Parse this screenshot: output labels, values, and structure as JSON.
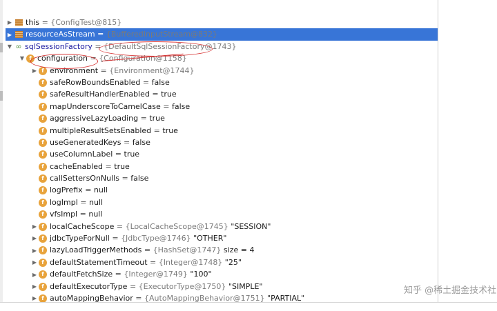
{
  "rows": [
    {
      "indent": 0,
      "arrow": "collapsed",
      "icon": "list",
      "name": "this",
      "eq": " = ",
      "ref": "{ConfigTest@815}",
      "value": ""
    },
    {
      "indent": 0,
      "arrow": "collapsed",
      "icon": "list",
      "name": "resourceAsStream",
      "eq": " = ",
      "ref": "{BufferedInputStream@832}",
      "value": "",
      "selected": true
    },
    {
      "indent": 0,
      "arrow": "expanded",
      "icon": "link",
      "name": "sqlSessionFactory",
      "eq": " = ",
      "ref": "{DefaultSqlSessionFactory@1743}",
      "value": "",
      "highlight": true
    },
    {
      "indent": 1,
      "arrow": "expanded",
      "icon": "field",
      "name": "configuration",
      "eq": " = ",
      "ref": "{Configuration@1158}",
      "value": ""
    },
    {
      "indent": 2,
      "arrow": "collapsed",
      "icon": "field",
      "name": "environment",
      "eq": " = ",
      "ref": "{Environment@1744}",
      "value": ""
    },
    {
      "indent": 2,
      "arrow": "none",
      "icon": "field",
      "name": "safeRowBoundsEnabled",
      "eq": " = ",
      "ref": "",
      "value": "false"
    },
    {
      "indent": 2,
      "arrow": "none",
      "icon": "field",
      "name": "safeResultHandlerEnabled",
      "eq": " = ",
      "ref": "",
      "value": "true"
    },
    {
      "indent": 2,
      "arrow": "none",
      "icon": "field",
      "name": "mapUnderscoreToCamelCase",
      "eq": " = ",
      "ref": "",
      "value": "false"
    },
    {
      "indent": 2,
      "arrow": "none",
      "icon": "field",
      "name": "aggressiveLazyLoading",
      "eq": " = ",
      "ref": "",
      "value": "true"
    },
    {
      "indent": 2,
      "arrow": "none",
      "icon": "field",
      "name": "multipleResultSetsEnabled",
      "eq": " = ",
      "ref": "",
      "value": "true"
    },
    {
      "indent": 2,
      "arrow": "none",
      "icon": "field",
      "name": "useGeneratedKeys",
      "eq": " = ",
      "ref": "",
      "value": "false"
    },
    {
      "indent": 2,
      "arrow": "none",
      "icon": "field",
      "name": "useColumnLabel",
      "eq": " = ",
      "ref": "",
      "value": "true"
    },
    {
      "indent": 2,
      "arrow": "none",
      "icon": "field",
      "name": "cacheEnabled",
      "eq": " = ",
      "ref": "",
      "value": "true"
    },
    {
      "indent": 2,
      "arrow": "none",
      "icon": "field",
      "name": "callSettersOnNulls",
      "eq": " = ",
      "ref": "",
      "value": "false"
    },
    {
      "indent": 2,
      "arrow": "none",
      "icon": "field",
      "name": "logPrefix",
      "eq": " = ",
      "ref": "",
      "value": "null"
    },
    {
      "indent": 2,
      "arrow": "none",
      "icon": "field",
      "name": "logImpl",
      "eq": " = ",
      "ref": "",
      "value": "null"
    },
    {
      "indent": 2,
      "arrow": "none",
      "icon": "field",
      "name": "vfsImpl",
      "eq": " = ",
      "ref": "",
      "value": "null"
    },
    {
      "indent": 2,
      "arrow": "collapsed",
      "icon": "field",
      "name": "localCacheScope",
      "eq": " = ",
      "ref": "{LocalCacheScope@1745}",
      "value": " \"SESSION\""
    },
    {
      "indent": 2,
      "arrow": "collapsed",
      "icon": "field",
      "name": "jdbcTypeForNull",
      "eq": " = ",
      "ref": "{JdbcType@1746}",
      "value": " \"OTHER\""
    },
    {
      "indent": 2,
      "arrow": "collapsed",
      "icon": "field",
      "name": "lazyLoadTriggerMethods",
      "eq": " = ",
      "ref": "{HashSet@1747}",
      "value": "  size = 4"
    },
    {
      "indent": 2,
      "arrow": "collapsed",
      "icon": "field",
      "name": "defaultStatementTimeout",
      "eq": " = ",
      "ref": "{Integer@1748}",
      "value": " \"25\""
    },
    {
      "indent": 2,
      "arrow": "collapsed",
      "icon": "field",
      "name": "defaultFetchSize",
      "eq": " = ",
      "ref": "{Integer@1749}",
      "value": " \"100\""
    },
    {
      "indent": 2,
      "arrow": "collapsed",
      "icon": "field",
      "name": "defaultExecutorType",
      "eq": " = ",
      "ref": "{ExecutorType@1750}",
      "value": " \"SIMPLE\""
    },
    {
      "indent": 2,
      "arrow": "collapsed",
      "icon": "field",
      "name": "autoMappingBehavior",
      "eq": " = ",
      "ref": "{AutoMappingBehavior@1751}",
      "value": " \"PARTIAL\""
    }
  ],
  "watermark": "知乎 @稀土掘金技术社区",
  "colors": {
    "selection": "#3875d7",
    "field_icon": "#e8a33c",
    "annotation": "#d63333"
  }
}
